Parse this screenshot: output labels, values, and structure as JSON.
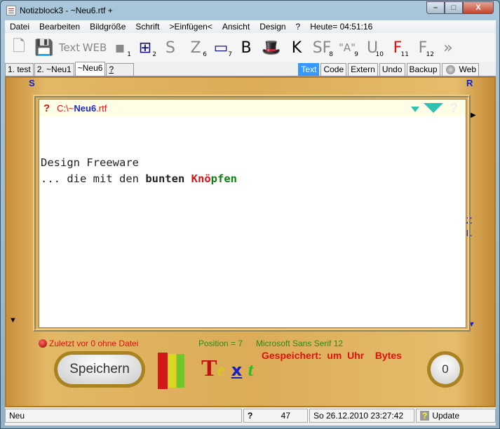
{
  "window": {
    "title": "Notizblock3 - ~Neu6.rtf +",
    "minimize": "–",
    "maximize": "□",
    "close": "X"
  },
  "menu": [
    "Datei",
    "Bearbeiten",
    "Bildgröße",
    "Schrift",
    ">Einfügen<",
    "Ansicht",
    "Design",
    "?",
    "Heute= 04:51:16"
  ],
  "toolbar": [
    {
      "icon": "new-file-icon",
      "glyph": "🗋",
      "num": ""
    },
    {
      "icon": "save-icon",
      "glyph": "💾",
      "num": ""
    },
    {
      "icon": "text-icon",
      "glyph": "Text",
      "num": ""
    },
    {
      "icon": "web-icon",
      "glyph": "WEB",
      "num": ""
    },
    {
      "icon": "insert-icon",
      "glyph": "▪",
      "num": "1"
    },
    {
      "icon": "add-icon",
      "glyph": "⊞",
      "num": "2"
    },
    {
      "icon": "s-icon",
      "glyph": "S",
      "num": ""
    },
    {
      "icon": "z-icon",
      "glyph": "Z",
      "num": "6"
    },
    {
      "icon": "window-icon",
      "glyph": "▭",
      "num": "7"
    },
    {
      "icon": "bold-icon",
      "glyph": "B",
      "num": ""
    },
    {
      "icon": "magic-hat-icon",
      "glyph": "🎩",
      "num": ""
    },
    {
      "icon": "k-icon",
      "glyph": "K",
      "num": ""
    },
    {
      "icon": "sf-icon",
      "glyph": "SF",
      "num": "8"
    },
    {
      "icon": "quote-a-icon",
      "glyph": "\"A\"",
      "num": "9"
    },
    {
      "icon": "underline-icon",
      "glyph": "U",
      "num": "10"
    },
    {
      "icon": "font-red-icon",
      "glyph": "F",
      "num": "11"
    },
    {
      "icon": "font-gray-icon",
      "glyph": "F",
      "num": "12"
    },
    {
      "icon": "more-icon",
      "glyph": "»",
      "num": ""
    }
  ],
  "tabs": [
    "1. test",
    "2. ~Neu1",
    "~Neu6",
    "?"
  ],
  "active_tab": "~Neu6",
  "right_tabs": [
    "Text",
    "Code",
    "Extern",
    "Undo",
    "Backup",
    "Web"
  ],
  "corner_labels": {
    "s": "S",
    "r": "R",
    "z": "Z",
    "l": "L"
  },
  "editor": {
    "help": "?",
    "path_prefix": "C:\\~",
    "file_name": "Neu6",
    "file_ext": ".rtf",
    "line1": "Design Freeware",
    "line2_a": "... die mit den ",
    "line2_b": "bunten",
    "line2_c": " ",
    "line2_d": "Knö",
    "line2_e": "pfen"
  },
  "info": {
    "last": "Zuletzt vor 0 ohne Datei",
    "position": "Position = 7",
    "font": "Microsoft Sans Serif 12",
    "saved": "Gespeichert:  um  Uhr    Bytes",
    "save_button": "Speichern",
    "counter": "0",
    "logo": {
      "t": "T",
      "e": "e",
      "x": "x",
      "t2": "t"
    }
  },
  "status": {
    "mode": "Neu",
    "help": "?",
    "count": "47",
    "datetime": "So 26.12.2010 23:27:42",
    "update": "Update"
  },
  "colors": {
    "accent": "#3399ff",
    "wood": "#dcac58",
    "red": "#e01010",
    "green": "#108010",
    "blue": "#1520c8"
  }
}
